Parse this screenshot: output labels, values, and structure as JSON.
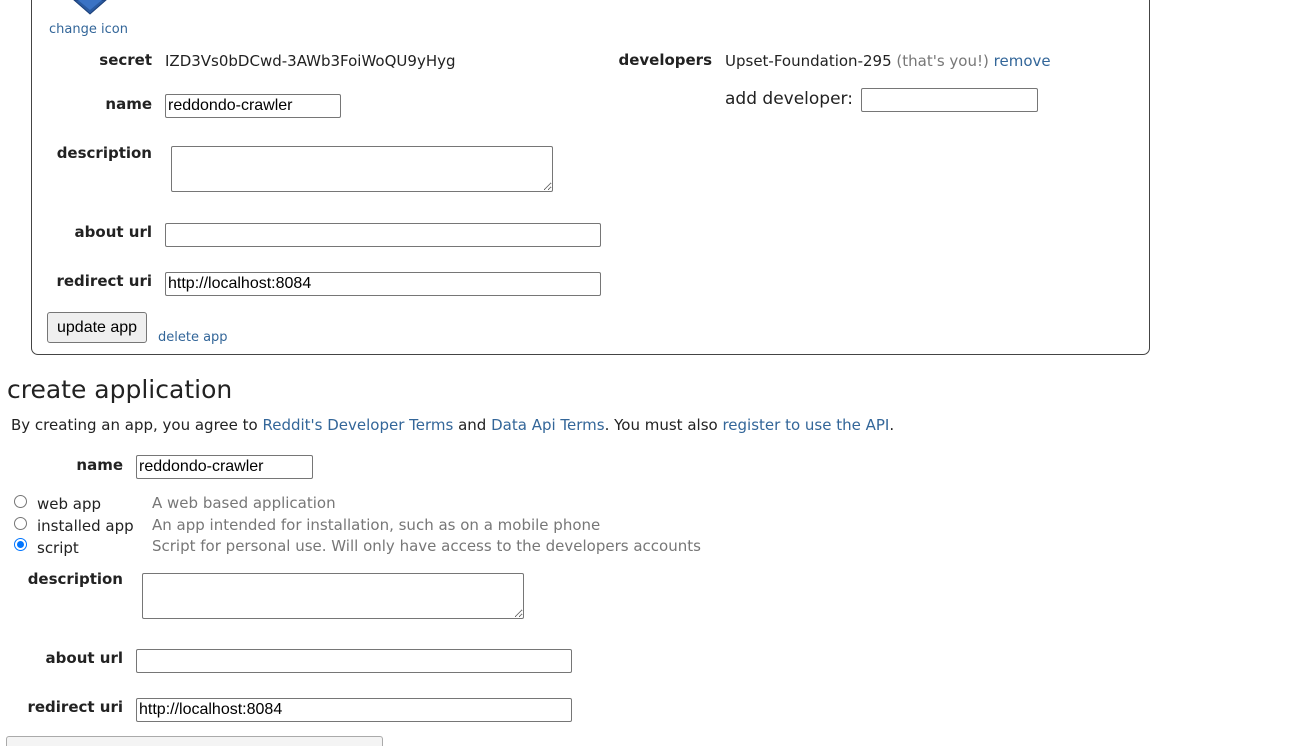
{
  "edit_app": {
    "change_icon_label": "change icon",
    "secret_label": "secret",
    "secret_value": "IZD3Vs0bDCwd-3AWb3FoiWoQU9yHyg",
    "developers_label": "developers",
    "developer_name": "Upset-Foundation-295",
    "developer_you": "(that's you!)",
    "remove_label": "remove",
    "add_developer_label": "add developer:",
    "add_developer_value": "",
    "name_label": "name",
    "name_value": "reddondo-crawler",
    "description_label": "description",
    "description_value": "",
    "about_url_label": "about url",
    "about_url_value": "",
    "redirect_uri_label": "redirect uri",
    "redirect_uri_value": "http://localhost:8084",
    "update_button": "update app",
    "delete_link": "delete app"
  },
  "create_app": {
    "title": "create application",
    "terms_prefix": "By creating an app, you agree to ",
    "terms_link1": "Reddit's Developer Terms",
    "terms_and": " and ",
    "terms_link2": "Data Api Terms",
    "terms_mid": ". You must also ",
    "terms_link3": "register to use the API",
    "terms_end": ".",
    "name_label": "name",
    "name_value": "reddondo-crawler",
    "app_types": [
      {
        "label": "web app",
        "description": "A web based application",
        "checked": false
      },
      {
        "label": "installed app",
        "description": "An app intended for installation, such as on a mobile phone",
        "checked": false
      },
      {
        "label": "script",
        "description": "Script for personal use. Will only have access to the developers accounts",
        "checked": true
      }
    ],
    "description_label": "description",
    "description_value": "",
    "about_url_label": "about url",
    "about_url_value": "",
    "redirect_uri_label": "redirect uri",
    "redirect_uri_value": "http://localhost:8084"
  },
  "colors": {
    "link": "#336699",
    "radio_accent": "#0075ff",
    "icon": "#336699"
  }
}
